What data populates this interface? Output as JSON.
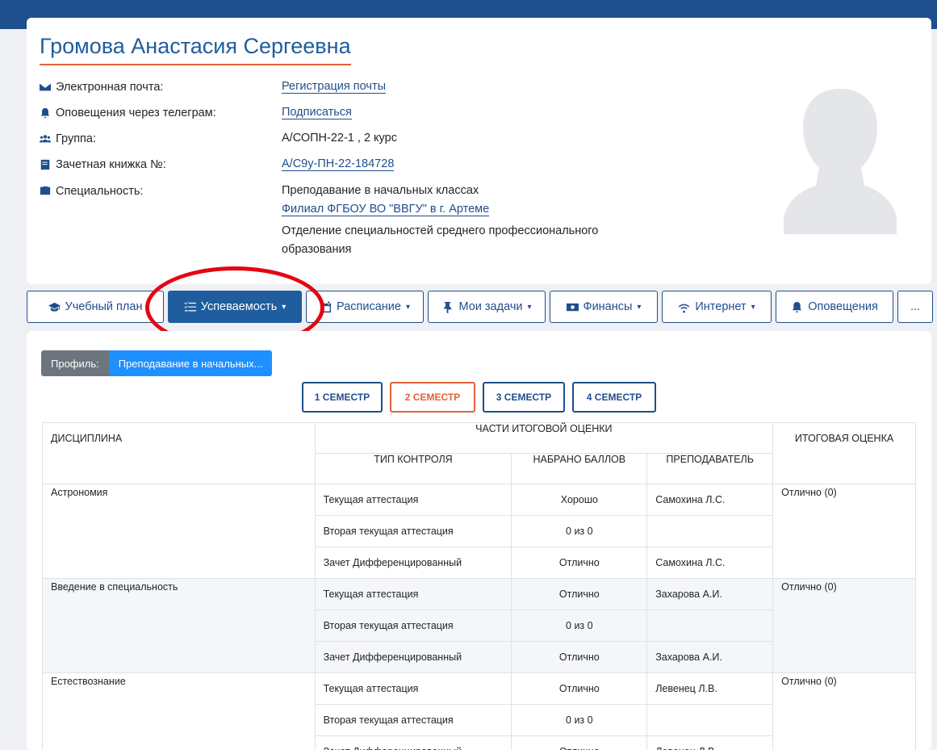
{
  "student": {
    "name": "Громова Анастасия Сергеевна",
    "rows": [
      {
        "label": "Электронная почта:",
        "icon": "envelope-icon",
        "value": "Регистрация почты",
        "is_link": true
      },
      {
        "label": "Оповещения через телеграм:",
        "icon": "bell-icon",
        "value": "Подписаться",
        "is_link": true
      },
      {
        "label": "Группа:",
        "icon": "users-icon",
        "value": "А/СОПН-22-1 , 2 курс",
        "is_link": false
      },
      {
        "label": "Зачетная книжка №:",
        "icon": "book-icon",
        "value": "А/С9у-ПН-22-184728",
        "is_link": true
      }
    ],
    "specialty_label": "Специальность:",
    "specialty_lines": {
      "program": "Преподавание в начальных классах",
      "branch": "Филиал ФГБОУ ВО \"ВВГУ\" в г. Артеме",
      "department": "Отделение специальностей среднего профессионального образования"
    }
  },
  "nav": {
    "study_plan": "Учебный план",
    "performance": "Успеваемость",
    "schedule": "Расписание",
    "tasks": "Мои задачи",
    "finance": "Финансы",
    "internet": "Интернет",
    "notifications": "Оповещения",
    "more": "..."
  },
  "profile_selector": {
    "label": "Профиль:",
    "value": "Преподавание в начальных..."
  },
  "semesters": [
    "1 СЕМЕСТР",
    "2 СЕМЕСТР",
    "3 СЕМЕСТР",
    "4 СЕМЕСТР"
  ],
  "active_semester": "2 СЕМЕСТР",
  "table": {
    "headers": {
      "discipline": "ДИСЦИПЛИНА",
      "parts": "ЧАСТИ ИТОГОВОЙ ОЦЕНКИ",
      "final": "ИТОГОВАЯ ОЦЕНКА",
      "control_type": "ТИП КОНТРОЛЯ",
      "score": "НАБРАНО БАЛЛОВ",
      "teacher": "ПРЕПОДАВАТЕЛЬ"
    },
    "subjects": [
      {
        "name": "Астрономия",
        "final": "Отлично (0)",
        "rows": [
          {
            "type": "Текущая аттестация",
            "score": "Хорошо",
            "teacher": "Самохина Л.С."
          },
          {
            "type": "Вторая текущая аттестация",
            "score": "0 из 0",
            "teacher": ""
          },
          {
            "type": "Зачет Дифференцированный",
            "score": "Отлично",
            "teacher": "Самохина Л.С."
          }
        ]
      },
      {
        "name": "Введение в специальность",
        "final": "Отлично (0)",
        "rows": [
          {
            "type": "Текущая аттестация",
            "score": "Отлично",
            "teacher": "Захарова А.И."
          },
          {
            "type": "Вторая текущая аттестация",
            "score": "0 из 0",
            "teacher": ""
          },
          {
            "type": "Зачет Дифференцированный",
            "score": "Отлично",
            "teacher": "Захарова А.И."
          }
        ]
      },
      {
        "name": "Естествознание",
        "final": "Отлично (0)",
        "rows": [
          {
            "type": "Текущая аттестация",
            "score": "Отлично",
            "teacher": "Левенец Л.В."
          },
          {
            "type": "Вторая текущая аттестация",
            "score": "0 из 0",
            "teacher": ""
          },
          {
            "type": "Зачет Дифференцированный",
            "score": "Отлично",
            "teacher": "Левенец Л.В."
          }
        ]
      }
    ]
  },
  "colors": {
    "primary": "#1f4e8c",
    "accent": "#e0633a",
    "annotation": "#e30613",
    "pill_blue": "#1e90ff"
  }
}
